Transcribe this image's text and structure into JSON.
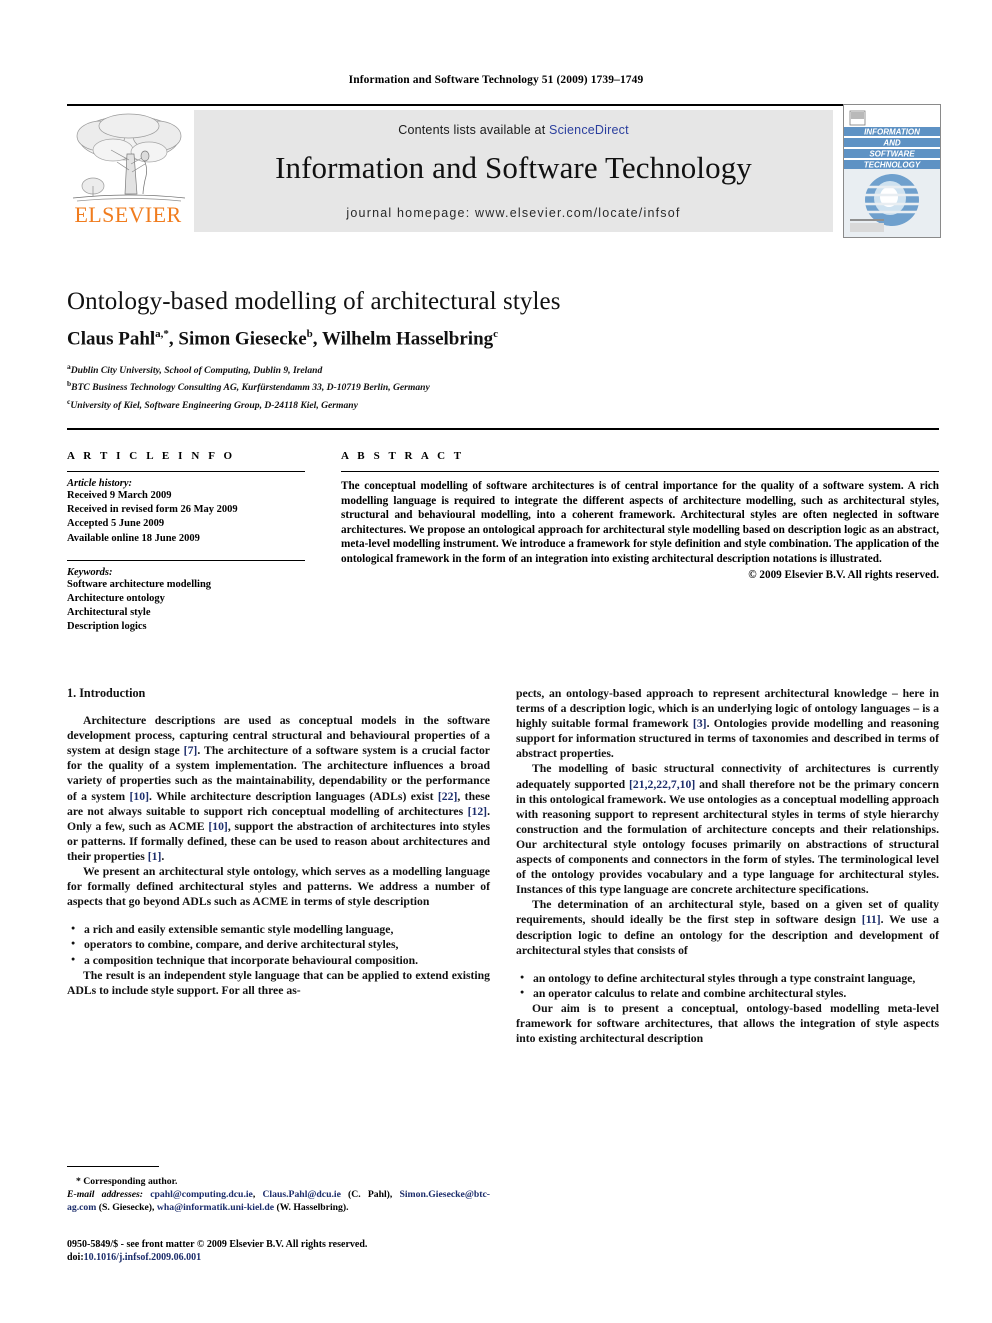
{
  "running_head": "Information and Software Technology 51 (2009) 1739–1749",
  "masthead": {
    "publisher_name": "ELSEVIER",
    "contents_prefix": "Contents lists available at ",
    "sciencedirect": "ScienceDirect",
    "journal_title": "Information and Software Technology",
    "homepage": "journal homepage: www.elsevier.com/locate/infsof",
    "cover_lines": [
      "INFORMATION",
      "AND",
      "SOFTWARE",
      "TECHNOLOGY"
    ],
    "sciencedirect_color": "#2b3f9e",
    "elsevier_orange": "#F07C1E",
    "banner_bg": "#e6e6e6"
  },
  "article": {
    "title": "Ontology-based modelling of architectural styles",
    "authors_html": "Claus Pahl<sup>a,*</sup>, Simon Giesecke<sup>b</sup>, Wilhelm Hasselbring<sup>c</sup>",
    "affiliations": [
      "Dublin City University, School of Computing, Dublin 9, Ireland",
      "BTC Business Technology Consulting AG, Kurfürstendamm 33, D-10719 Berlin, Germany",
      "University of Kiel, Software Engineering Group, D-24118 Kiel, Germany"
    ],
    "affiliation_marks": [
      "a",
      "b",
      "c"
    ]
  },
  "article_info": {
    "heading": "A R T I C L E   I N F O",
    "history_label": "Article history:",
    "history": [
      "Received 9 March 2009",
      "Received in revised form 26 May 2009",
      "Accepted 5 June 2009",
      "Available online 18 June 2009"
    ],
    "keywords_label": "Keywords:",
    "keywords": [
      "Software architecture modelling",
      "Architecture ontology",
      "Architectural style",
      "Description logics"
    ]
  },
  "abstract": {
    "heading": "A B S T R A C T",
    "text": "The conceptual modelling of software architectures is of central importance for the quality of a software system. A rich modelling language is required to integrate the different aspects of architecture modelling, such as architectural styles, structural and behavioural modelling, into a coherent framework. Architectural styles are often neglected in software architectures. We propose an ontological approach for architectural style modelling based on description logic as an abstract, meta-level modelling instrument. We introduce a framework for style definition and style combination. The application of the ontological framework in the form of an integration into existing architectural description notations is illustrated.",
    "copyright": "© 2009 Elsevier B.V. All rights reserved."
  },
  "body": {
    "section_title": "1. Introduction",
    "left": {
      "paragraph_1_parts": [
        {
          "t": "Architecture descriptions are used as conceptual models in the software development process, capturing central structural and behavioural properties of a system at design stage "
        },
        {
          "t": "[7]",
          "ref": true
        },
        {
          "t": ". The architecture of a software system is a crucial factor for the quality of a system implementation. The architecture influences a broad variety of properties such as the maintainability, dependability or the performance of a system "
        },
        {
          "t": "[10]",
          "ref": true
        },
        {
          "t": ". While architecture description languages (ADLs) exist "
        },
        {
          "t": "[22]",
          "ref": true
        },
        {
          "t": ", these are not always suitable to support rich conceptual modelling of architectures "
        },
        {
          "t": "[12]",
          "ref": true
        },
        {
          "t": ". Only a few, such as ACME "
        },
        {
          "t": "[10]",
          "ref": true
        },
        {
          "t": ", support the abstraction of architectures into styles or patterns. If formally defined, these can be used to reason about architectures and their properties "
        },
        {
          "t": "[1]",
          "ref": true
        },
        {
          "t": "."
        }
      ],
      "paragraph_2": "We present an architectural style ontology, which serves as a modelling language for formally defined architectural styles and patterns. We address a number of aspects that go beyond ADLs such as ACME in terms of style description",
      "bullets": [
        "a rich and easily extensible semantic style modelling language,",
        "operators to combine, compare, and derive architectural styles,",
        "a composition technique that incorporate behavioural composition."
      ],
      "paragraph_3": "The result is an independent style language that can be applied to extend existing ADLs to include style support. For all three as-"
    },
    "right": {
      "paragraph_1_parts": [
        {
          "t": "pects, an ontology-based approach to represent architectural knowledge – here in terms of a description logic, which is an underlying logic of ontology languages – is a highly suitable formal framework "
        },
        {
          "t": "[3]",
          "ref": true
        },
        {
          "t": ". Ontologies provide modelling and reasoning support for information structured in terms of taxonomies and described in terms of abstract properties."
        }
      ],
      "paragraph_2_parts": [
        {
          "t": "The modelling of basic structural connectivity of architectures is currently adequately supported "
        },
        {
          "t": "[21,2,22,7,10]",
          "ref": true
        },
        {
          "t": " and shall therefore not be the primary concern in this ontological framework. We use ontologies as a conceptual modelling approach with reasoning support to represent architectural styles in terms of style hierarchy construction and the formulation of architecture concepts and their relationships. Our architectural style ontology focuses primarily on abstractions of structural aspects of components and connectors in the form of styles. The terminological level of the ontology provides vocabulary and a type language for architectural styles. Instances of this type language are concrete architecture specifications."
        }
      ],
      "paragraph_3_parts": [
        {
          "t": "The determination of an architectural style, based on a given set of quality requirements, should ideally be the first step in software design "
        },
        {
          "t": "[11]",
          "ref": true
        },
        {
          "t": ". We use a description logic to define an ontology for the description and development of architectural styles that consists of"
        }
      ],
      "bullets": [
        "an ontology to define architectural styles through a type constraint language,",
        "an operator calculus to relate and combine architectural styles."
      ],
      "paragraph_4": "Our aim is to present a conceptual, ontology-based modelling meta-level framework for software architectures, that allows the integration of style aspects into existing architectural description"
    }
  },
  "footnote": {
    "corresponding_mark": "*",
    "corresponding_text": "Corresponding author.",
    "email_label": "E-mail addresses:",
    "emails": [
      {
        "address": "cpahl@computing.dcu.ie",
        "sep": ", "
      },
      {
        "address": "Claus.Pahl@dcu.ie",
        "owner": " (C. Pahl), "
      },
      {
        "address": "Simon.Giesecke@btc-ag.com",
        "owner": " (S. Giesecke), "
      },
      {
        "address": "wha@informatik.uni-kiel.de",
        "owner": " (W. Hasselbring)."
      }
    ],
    "link_color": "#1c2d6b"
  },
  "colophon": {
    "line1": "0950-5849/$ - see front matter © 2009 Elsevier B.V. All rights reserved.",
    "doi_label": "doi:",
    "doi_value": "10.1016/j.infsof.2009.06.001"
  }
}
